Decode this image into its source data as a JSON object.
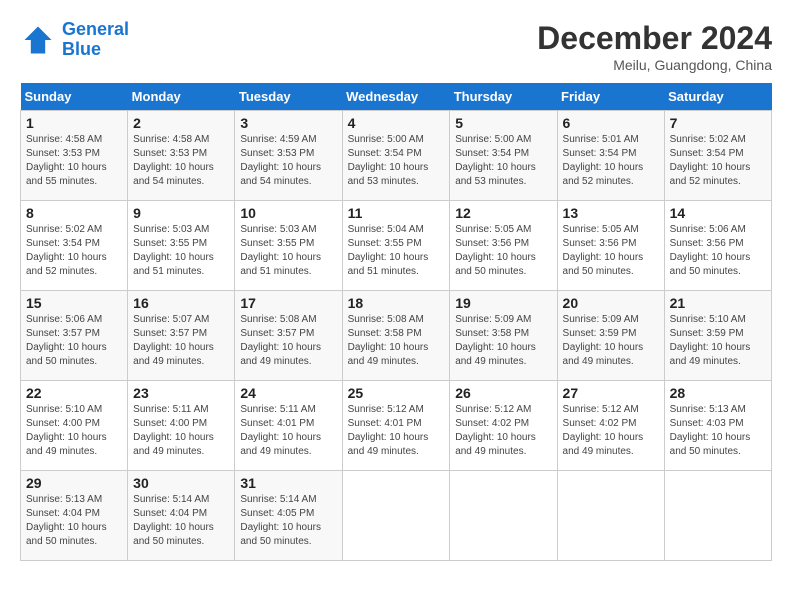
{
  "logo": {
    "line1": "General",
    "line2": "Blue"
  },
  "title": "December 2024",
  "subtitle": "Meilu, Guangdong, China",
  "days_of_week": [
    "Sunday",
    "Monday",
    "Tuesday",
    "Wednesday",
    "Thursday",
    "Friday",
    "Saturday"
  ],
  "weeks": [
    [
      {
        "num": "1",
        "sunrise": "4:58 AM",
        "sunset": "3:53 PM",
        "daylight": "10 hours and 55 minutes."
      },
      {
        "num": "2",
        "sunrise": "4:58 AM",
        "sunset": "3:53 PM",
        "daylight": "10 hours and 54 minutes."
      },
      {
        "num": "3",
        "sunrise": "4:59 AM",
        "sunset": "3:53 PM",
        "daylight": "10 hours and 54 minutes."
      },
      {
        "num": "4",
        "sunrise": "5:00 AM",
        "sunset": "3:54 PM",
        "daylight": "10 hours and 53 minutes."
      },
      {
        "num": "5",
        "sunrise": "5:00 AM",
        "sunset": "3:54 PM",
        "daylight": "10 hours and 53 minutes."
      },
      {
        "num": "6",
        "sunrise": "5:01 AM",
        "sunset": "3:54 PM",
        "daylight": "10 hours and 52 minutes."
      },
      {
        "num": "7",
        "sunrise": "5:02 AM",
        "sunset": "3:54 PM",
        "daylight": "10 hours and 52 minutes."
      }
    ],
    [
      {
        "num": "8",
        "sunrise": "5:02 AM",
        "sunset": "3:54 PM",
        "daylight": "10 hours and 52 minutes."
      },
      {
        "num": "9",
        "sunrise": "5:03 AM",
        "sunset": "3:55 PM",
        "daylight": "10 hours and 51 minutes."
      },
      {
        "num": "10",
        "sunrise": "5:03 AM",
        "sunset": "3:55 PM",
        "daylight": "10 hours and 51 minutes."
      },
      {
        "num": "11",
        "sunrise": "5:04 AM",
        "sunset": "3:55 PM",
        "daylight": "10 hours and 51 minutes."
      },
      {
        "num": "12",
        "sunrise": "5:05 AM",
        "sunset": "3:56 PM",
        "daylight": "10 hours and 50 minutes."
      },
      {
        "num": "13",
        "sunrise": "5:05 AM",
        "sunset": "3:56 PM",
        "daylight": "10 hours and 50 minutes."
      },
      {
        "num": "14",
        "sunrise": "5:06 AM",
        "sunset": "3:56 PM",
        "daylight": "10 hours and 50 minutes."
      }
    ],
    [
      {
        "num": "15",
        "sunrise": "5:06 AM",
        "sunset": "3:57 PM",
        "daylight": "10 hours and 50 minutes."
      },
      {
        "num": "16",
        "sunrise": "5:07 AM",
        "sunset": "3:57 PM",
        "daylight": "10 hours and 49 minutes."
      },
      {
        "num": "17",
        "sunrise": "5:08 AM",
        "sunset": "3:57 PM",
        "daylight": "10 hours and 49 minutes."
      },
      {
        "num": "18",
        "sunrise": "5:08 AM",
        "sunset": "3:58 PM",
        "daylight": "10 hours and 49 minutes."
      },
      {
        "num": "19",
        "sunrise": "5:09 AM",
        "sunset": "3:58 PM",
        "daylight": "10 hours and 49 minutes."
      },
      {
        "num": "20",
        "sunrise": "5:09 AM",
        "sunset": "3:59 PM",
        "daylight": "10 hours and 49 minutes."
      },
      {
        "num": "21",
        "sunrise": "5:10 AM",
        "sunset": "3:59 PM",
        "daylight": "10 hours and 49 minutes."
      }
    ],
    [
      {
        "num": "22",
        "sunrise": "5:10 AM",
        "sunset": "4:00 PM",
        "daylight": "10 hours and 49 minutes."
      },
      {
        "num": "23",
        "sunrise": "5:11 AM",
        "sunset": "4:00 PM",
        "daylight": "10 hours and 49 minutes."
      },
      {
        "num": "24",
        "sunrise": "5:11 AM",
        "sunset": "4:01 PM",
        "daylight": "10 hours and 49 minutes."
      },
      {
        "num": "25",
        "sunrise": "5:12 AM",
        "sunset": "4:01 PM",
        "daylight": "10 hours and 49 minutes."
      },
      {
        "num": "26",
        "sunrise": "5:12 AM",
        "sunset": "4:02 PM",
        "daylight": "10 hours and 49 minutes."
      },
      {
        "num": "27",
        "sunrise": "5:12 AM",
        "sunset": "4:02 PM",
        "daylight": "10 hours and 49 minutes."
      },
      {
        "num": "28",
        "sunrise": "5:13 AM",
        "sunset": "4:03 PM",
        "daylight": "10 hours and 50 minutes."
      }
    ],
    [
      {
        "num": "29",
        "sunrise": "5:13 AM",
        "sunset": "4:04 PM",
        "daylight": "10 hours and 50 minutes."
      },
      {
        "num": "30",
        "sunrise": "5:14 AM",
        "sunset": "4:04 PM",
        "daylight": "10 hours and 50 minutes."
      },
      {
        "num": "31",
        "sunrise": "5:14 AM",
        "sunset": "4:05 PM",
        "daylight": "10 hours and 50 minutes."
      },
      null,
      null,
      null,
      null
    ]
  ]
}
